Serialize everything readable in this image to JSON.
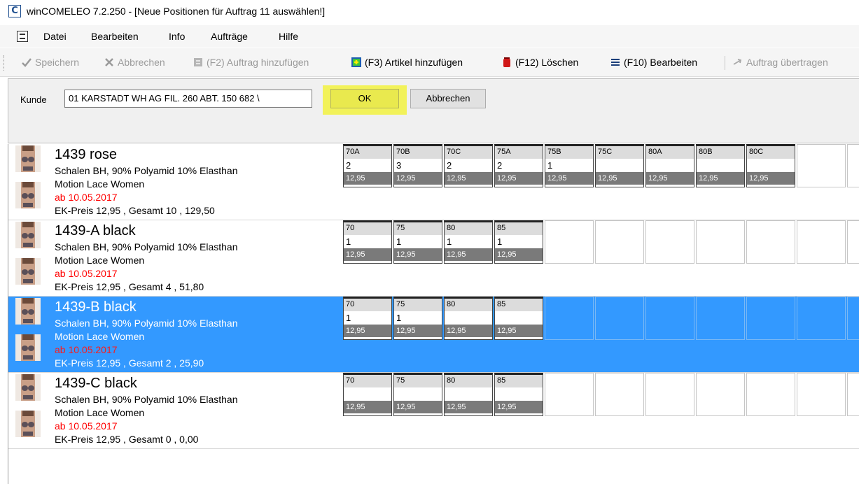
{
  "window": {
    "icon_letter": "C",
    "title": "winCOMELEO 7.2.250 - [Neue Positionen für Auftrag 11 auswählen!]"
  },
  "menu": {
    "items": [
      "Datei",
      "Bearbeiten",
      "Info",
      "Aufträge",
      "Hilfe"
    ]
  },
  "toolbar": {
    "save": "Speichern",
    "cancel": "Abbrechen",
    "add_order": "(F2) Auftrag hinzufügen",
    "add_article": "(F3) Artikel hinzufügen",
    "delete": "(F12) Löschen",
    "edit": "(F10) Bearbeiten",
    "transfer": "Auftrag übertragen",
    "icons": [
      "check-icon",
      "x-icon",
      "add-order-icon",
      "add-article-icon",
      "trash-icon",
      "list-edit-icon",
      "arrow-transfer-icon"
    ]
  },
  "filter": {
    "customer_label": "Kunde",
    "customer_value": "01 KARSTADT WH AG FIL. 260 ABT. 150 682 \\",
    "ok_label": "OK",
    "cancel_label": "Abbrechen",
    "highlight_color": "#f2f25a"
  },
  "colors": {
    "selection": "#3399ff",
    "date_red": "#ff0000"
  },
  "articles": [
    {
      "name": "1439 rose",
      "description": "Schalen BH, 90% Polyamid 10% Elasthan",
      "line": "Motion Lace Women",
      "date": "ab 10.05.2017",
      "price_summary": "EK-Preis 12,95 , Gesamt 10 ,  129,50",
      "selected": false,
      "sizes": [
        {
          "size": "70A",
          "qty": "2",
          "price": "12,95"
        },
        {
          "size": "70B",
          "qty": "3",
          "price": "12,95"
        },
        {
          "size": "70C",
          "qty": "2",
          "price": "12,95"
        },
        {
          "size": "75A",
          "qty": "2",
          "price": "12,95"
        },
        {
          "size": "75B",
          "qty": "1",
          "price": "12,95"
        },
        {
          "size": "75C",
          "qty": "",
          "price": "12,95"
        },
        {
          "size": "80A",
          "qty": "",
          "price": "12,95"
        },
        {
          "size": "80B",
          "qty": "",
          "price": "12,95"
        },
        {
          "size": "80C",
          "qty": "",
          "price": "12,95"
        }
      ]
    },
    {
      "name": "1439-A black",
      "description": "Schalen BH, 90% Polyamid 10% Elasthan",
      "line": "Motion Lace Women",
      "date": "ab 10.05.2017",
      "price_summary": "EK-Preis 12,95 , Gesamt 4 ,  51,80",
      "selected": false,
      "sizes": [
        {
          "size": "70",
          "qty": "1",
          "price": "12,95"
        },
        {
          "size": "75",
          "qty": "1",
          "price": "12,95"
        },
        {
          "size": "80",
          "qty": "1",
          "price": "12,95"
        },
        {
          "size": "85",
          "qty": "1",
          "price": "12,95"
        }
      ]
    },
    {
      "name": "1439-B black",
      "description": "Schalen BH, 90% Polyamid 10% Elasthan",
      "line": "Motion Lace Women",
      "date": "ab 10.05.2017",
      "price_summary": "EK-Preis 12,95 , Gesamt 2 ,  25,90",
      "selected": true,
      "sizes": [
        {
          "size": "70",
          "qty": "1",
          "price": "12,95"
        },
        {
          "size": "75",
          "qty": "1",
          "price": "12,95"
        },
        {
          "size": "80",
          "qty": "",
          "price": "12,95"
        },
        {
          "size": "85",
          "qty": "",
          "price": "12,95"
        }
      ]
    },
    {
      "name": "1439-C black",
      "description": "Schalen BH, 90% Polyamid 10% Elasthan",
      "line": "Motion Lace Women",
      "date": "ab 10.05.2017",
      "price_summary": "EK-Preis 12,95 , Gesamt 0 ,  0,00",
      "selected": false,
      "sizes": [
        {
          "size": "70",
          "qty": "",
          "price": "12,95"
        },
        {
          "size": "75",
          "qty": "",
          "price": "12,95"
        },
        {
          "size": "80",
          "qty": "",
          "price": "12,95"
        },
        {
          "size": "85",
          "qty": "",
          "price": "12,95"
        }
      ]
    }
  ]
}
